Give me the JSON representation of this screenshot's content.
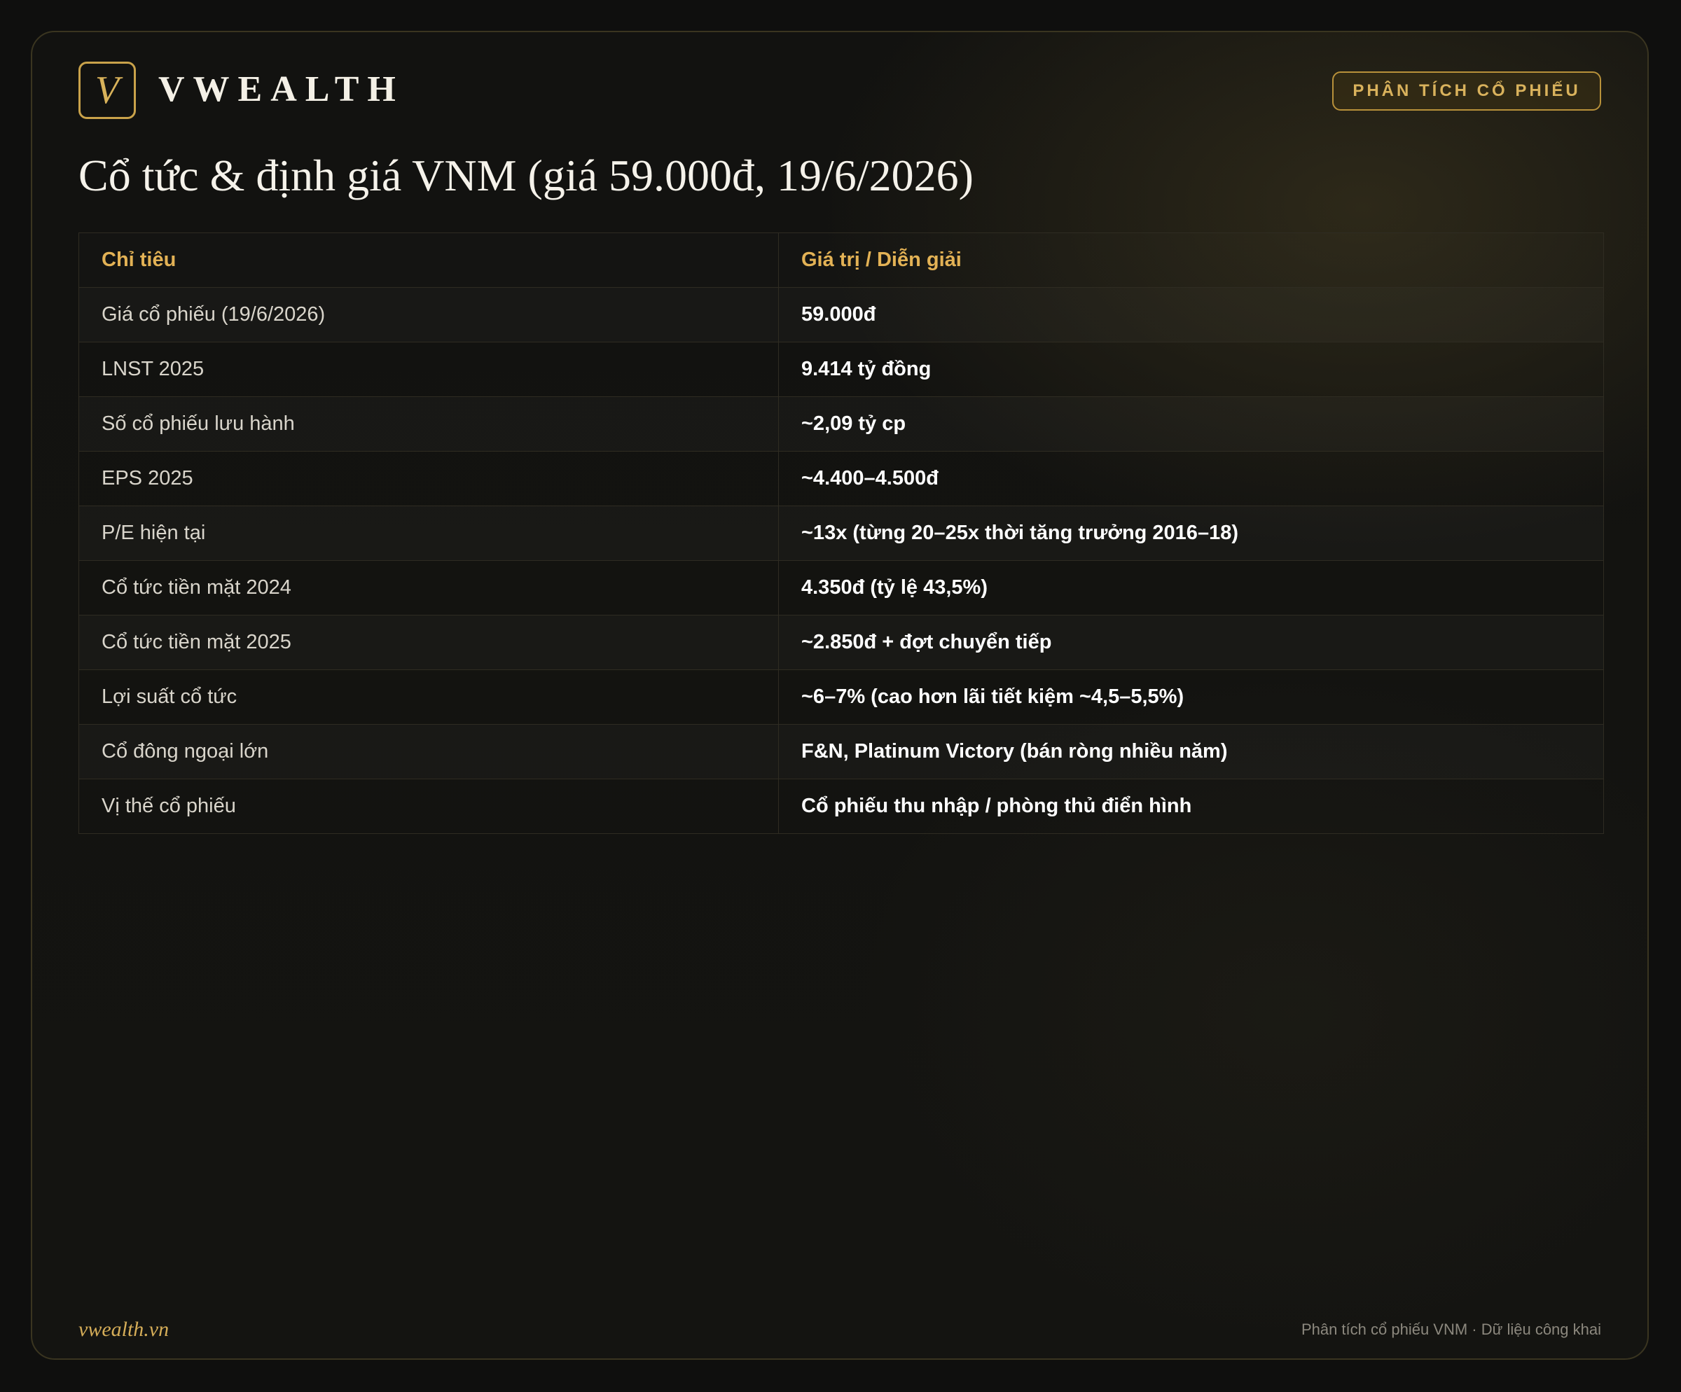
{
  "header": {
    "logo_letter": "V",
    "brand": "VWEALTH",
    "badge": "PHÂN TÍCH CỔ PHIẾU"
  },
  "title": "Cổ tức & định giá VNM (giá 59.000đ, 19/6/2026)",
  "table": {
    "columns": [
      "Chỉ tiêu",
      "Giá trị / Diễn giải"
    ],
    "rows": [
      {
        "label": "Giá cổ phiếu (19/6/2026)",
        "value": "59.000đ"
      },
      {
        "label": "LNST 2025",
        "value": "9.414 tỷ đồng"
      },
      {
        "label": "Số cổ phiếu lưu hành",
        "value": "~2,09 tỷ cp"
      },
      {
        "label": "EPS 2025",
        "value": "~4.400–4.500đ"
      },
      {
        "label": "P/E hiện tại",
        "value": "~13x (từng 20–25x thời tăng trưởng 2016–18)"
      },
      {
        "label": "Cổ tức tiền mặt 2024",
        "value": "4.350đ (tỷ lệ 43,5%)"
      },
      {
        "label": "Cổ tức tiền mặt 2025",
        "value": "~2.850đ + đợt chuyển tiếp"
      },
      {
        "label": "Lợi suất cổ tức",
        "value": "~6–7% (cao hơn lãi tiết kiệm ~4,5–5,5%)"
      },
      {
        "label": "Cổ đông ngoại lớn",
        "value": "F&N, Platinum Victory (bán ròng nhiều năm)"
      },
      {
        "label": "Vị thế cổ phiếu",
        "value": "Cổ phiếu thu nhập / phòng thủ điển hình"
      }
    ]
  },
  "footer": {
    "site": "vwealth.vn",
    "note": "Phân tích cổ phiếu VNM · Dữ liệu công khai"
  },
  "colors": {
    "accent_gold": "#e3b255",
    "background": "#121210",
    "text": "#f5f2ea"
  }
}
